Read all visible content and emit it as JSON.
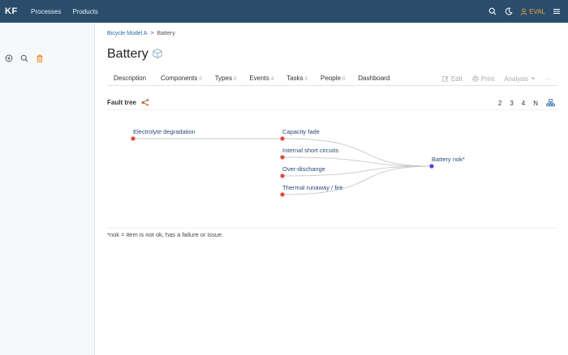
{
  "topbar": {
    "brand": "KF",
    "nav": [
      "Processes",
      "Products"
    ],
    "user_label": "EVAL",
    "icons": [
      "search-icon",
      "moon-icon",
      "user-icon",
      "menu-icon"
    ]
  },
  "sidebar": {
    "tools": [
      "add-circle-icon",
      "search-icon",
      "trash-icon"
    ]
  },
  "breadcrumb": {
    "parent": "Bicycle Model A",
    "separator": ">",
    "current": "Battery"
  },
  "page": {
    "title": "Battery"
  },
  "tabs": [
    {
      "label": "Description",
      "count": ""
    },
    {
      "label": "Components",
      "count": "0"
    },
    {
      "label": "Types",
      "count": "0"
    },
    {
      "label": "Events",
      "count": "4"
    },
    {
      "label": "Tasks",
      "count": "0"
    },
    {
      "label": "People",
      "count": "0"
    },
    {
      "label": "Dashboard",
      "count": ""
    }
  ],
  "actions": {
    "edit": "Edit",
    "print": "Print",
    "analysis": "Analysis",
    "more": "···"
  },
  "section": {
    "title": "Fault tree",
    "depth_buttons": [
      "2",
      "3",
      "4",
      "N"
    ]
  },
  "fault_tree": {
    "root": "Battery nok*",
    "causes": [
      "Capacity fade",
      "Internal short circuits",
      "Over-dischange",
      "Thermal runaway / fire"
    ],
    "sub_cause": {
      "label": "Electrolyte degradation",
      "parent": "Capacity fade"
    },
    "colors": {
      "cause": "#e0493a",
      "root": "#4a4ae0",
      "link": "#c9c9c9",
      "label": "#2a4a78"
    }
  },
  "footnote": "*nok = item is not ok, has a failure or issue."
}
